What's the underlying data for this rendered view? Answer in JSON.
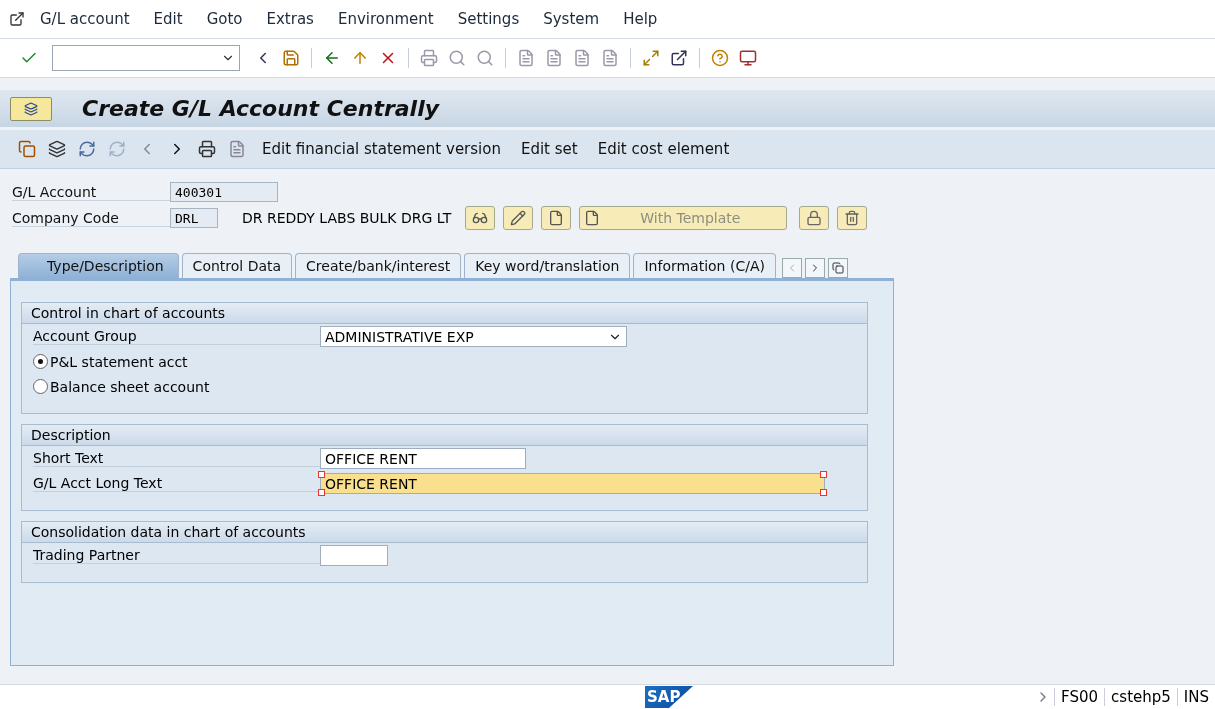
{
  "menu": [
    "G/L account",
    "Edit",
    "Goto",
    "Extras",
    "Environment",
    "Settings",
    "System",
    "Help"
  ],
  "title": "Create G/L Account Centrally",
  "app_toolbar": [
    "Edit financial statement version",
    "Edit set",
    "Edit cost element"
  ],
  "header": {
    "account_label": "G/L Account",
    "account_value": "400301",
    "company_label": "Company Code",
    "company_value": "DRL",
    "company_name": "DR REDDY LABS BULK DRG LT",
    "template_button": "With Template"
  },
  "tabs": [
    {
      "label": "Type/Description",
      "selected": true
    },
    {
      "label": "Control Data",
      "selected": false
    },
    {
      "label": "Create/bank/interest",
      "selected": false
    },
    {
      "label": "Key word/translation",
      "selected": false
    },
    {
      "label": "Information (C/A)",
      "selected": false
    }
  ],
  "sections": [
    {
      "title": "Control in chart of accounts",
      "rows": [
        {
          "kind": "dropdown",
          "label": "Account Group",
          "value": "ADMINISTRATIVE EXP"
        },
        {
          "kind": "radio",
          "label": "P&L statement acct",
          "selected": true
        },
        {
          "kind": "radio",
          "label": "Balance sheet account",
          "selected": false
        }
      ]
    },
    {
      "title": "Description",
      "rows": [
        {
          "kind": "field",
          "label": "Short Text",
          "value": "OFFICE RENT",
          "focused": false
        },
        {
          "kind": "long_field",
          "label": "G/L Acct Long Text",
          "value": "OFFICE RENT",
          "focused": true
        }
      ]
    },
    {
      "title": "Consolidation data in chart of accounts",
      "rows": [
        {
          "kind": "small_field",
          "label": "Trading Partner",
          "focused": false
        }
      ]
    }
  ],
  "status_bar": {
    "logo": "SAP",
    "transaction": "FS00",
    "system": "cstehp5",
    "mode": "INS"
  }
}
